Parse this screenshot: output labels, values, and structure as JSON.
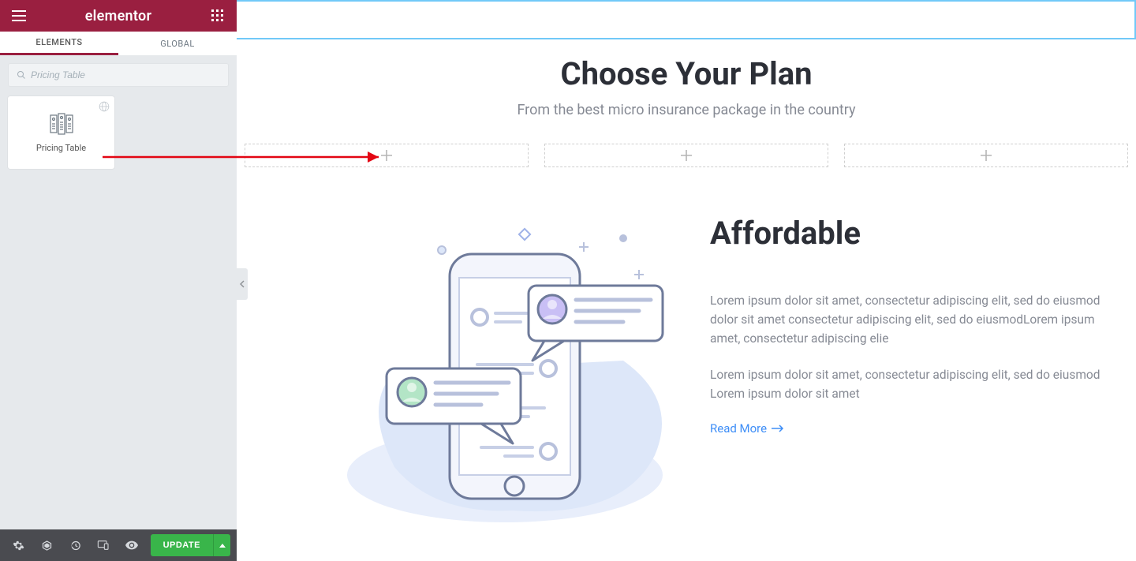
{
  "brand": "elementor",
  "tabs": {
    "elements": "ELEMENTS",
    "global": "GLOBAL"
  },
  "search": {
    "placeholder": "Pricing Table",
    "value": ""
  },
  "widget": {
    "label": "Pricing Table"
  },
  "footer": {
    "update": "UPDATE"
  },
  "hero": {
    "title": "Choose Your Plan",
    "subtitle": "From the best micro insurance package in the country"
  },
  "section2": {
    "title": "Affordable",
    "p1": "Lorem ipsum dolor sit amet, consectetur adipiscing elit, sed do eiusmod dolor sit amet consectetur adipiscing elit, sed do eiusmodLorem ipsum amet, consectetur adipiscing elie",
    "p2": "Lorem ipsum dolor sit amet, consectetur adipiscing elit, sed do eiusmod Lorem ipsum dolor sit amet",
    "readmore": "Read More"
  }
}
